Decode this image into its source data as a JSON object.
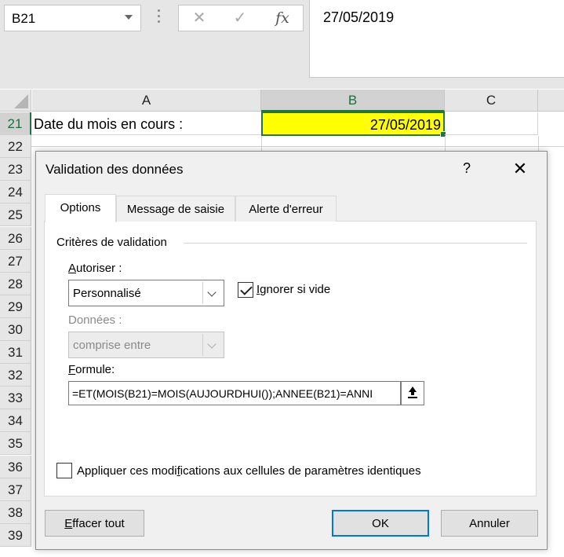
{
  "formula_bar": {
    "name_box": "B21",
    "cancel_icon": "cancel-icon",
    "enter_icon": "enter-icon",
    "fx_label": "fx",
    "content": "27/05/2019"
  },
  "grid": {
    "columns": [
      "A",
      "B",
      "C"
    ],
    "selected_column": "B",
    "rows": [
      "21",
      "22",
      "23",
      "24",
      "25",
      "26",
      "27",
      "28",
      "29",
      "30",
      "31",
      "32",
      "33",
      "34",
      "35",
      "36",
      "37",
      "38",
      "39"
    ],
    "selected_row": "21",
    "cells": {
      "A21": "Date du mois en cours :",
      "B21": "27/05/2019"
    },
    "colors": {
      "selected_fill": "#ffff00",
      "selection_border": "#217346"
    }
  },
  "dialog": {
    "title": "Validation des données",
    "help_label": "?",
    "close_label": "✕",
    "tabs": [
      {
        "label": "Options",
        "active": true
      },
      {
        "label": "Message de saisie",
        "active": false
      },
      {
        "label": "Alerte d'erreur",
        "active": false
      }
    ],
    "criteria_label": "Critères de validation",
    "allow": {
      "label_access": "A",
      "label_rest": "utoriser :",
      "value": "Personnalisé"
    },
    "ignore_blank": {
      "label_access": "I",
      "label_rest": "gnorer si vide",
      "checked": true
    },
    "data": {
      "label": "Données :",
      "value": "comprise entre",
      "disabled": true
    },
    "formula": {
      "label_access": "F",
      "label_rest": "ormule:",
      "value": "=ET(MOIS(B21)=MOIS(AUJOURDHUI());ANNEE(B21)=ANNI"
    },
    "apply_all": {
      "label_pre": "Appliquer ces modi",
      "label_access": "f",
      "label_post": "ications aux cellules de paramètres identiques",
      "checked": false
    },
    "buttons": {
      "clear_access": "E",
      "clear_rest": "ffacer tout",
      "ok": "OK",
      "cancel": "Annuler"
    },
    "colors": {
      "default_button_border": "#0078d7"
    }
  }
}
